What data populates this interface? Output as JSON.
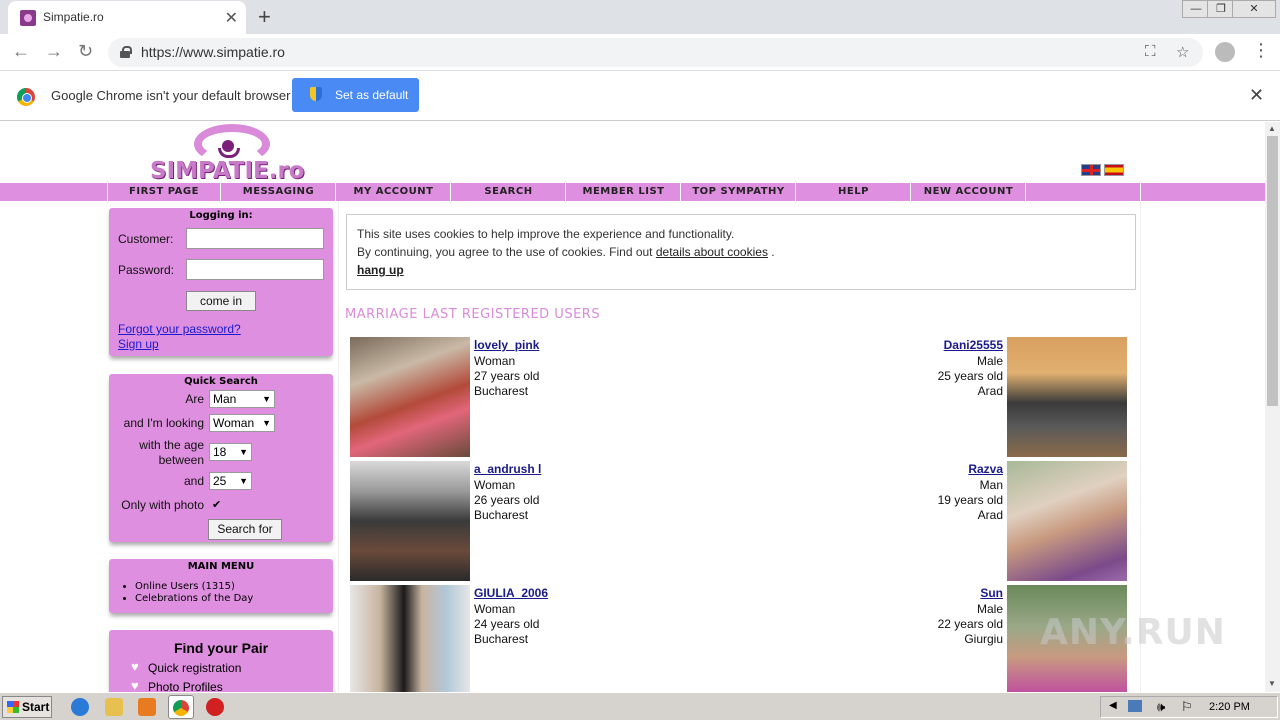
{
  "browser": {
    "tab_title": "Simpatie.ro",
    "url": "https://www.simpatie.ro",
    "infobar_text": "Google Chrome isn't your default browser",
    "infobar_button": "Set as default"
  },
  "site": {
    "logo_text": "SIMPATIE.ro",
    "nav": [
      "FIRST PAGE",
      "MESSAGING",
      "MY ACCOUNT",
      "SEARCH",
      "MEMBER LIST",
      "TOP SYMPATHY",
      "HELP",
      "NEW ACCOUNT"
    ]
  },
  "login": {
    "title": "Logging in:",
    "customer_label": "Customer:",
    "password_label": "Password:",
    "button": "come in",
    "forgot": "Forgot your password?",
    "signup": "Sign up"
  },
  "quick_search": {
    "title": "Quick Search",
    "are_label": "Are",
    "are_value": "Man",
    "looking_label": "and I'm looking",
    "looking_value": "Woman",
    "age_label_1": "with the age",
    "age_label_2": "between",
    "age_from": "18",
    "and_label": "and",
    "age_to": "25",
    "photo_label": "Only with photo",
    "photo_checked": true,
    "button": "Search for"
  },
  "main_menu": {
    "title": "MAIN MENU",
    "items": [
      "Online Users (1315)",
      "Celebrations of the Day"
    ]
  },
  "find_pair": {
    "title": "Find your Pair",
    "items": [
      "Quick registration",
      "Photo Profiles"
    ]
  },
  "cookie": {
    "line1": "This site uses cookies to help improve the experience and functionality.",
    "line2_pre": "By continuing, you agree to the use of cookies. Find out",
    "line2_link": "details about cookies",
    "line2_post": ".",
    "dismiss": "hang up"
  },
  "section_title": "MARRIAGE LAST REGISTERED USERS",
  "users_left": [
    {
      "name": "lovely_pink",
      "gender": "Woman",
      "age": "27 years old",
      "city": "Bucharest"
    },
    {
      "name": "a_andrush l",
      "gender": "Woman",
      "age": "26 years old",
      "city": "Bucharest"
    },
    {
      "name": "GIULIA_2006",
      "gender": "Woman",
      "age": "24 years old",
      "city": "Bucharest"
    }
  ],
  "users_right": [
    {
      "name": "Dani25555",
      "gender": "Male",
      "age": "25 years old",
      "city": "Arad"
    },
    {
      "name": "Razva",
      "gender": "Man",
      "age": "19 years old",
      "city": "Arad"
    },
    {
      "name": "Sun",
      "gender": "Male",
      "age": "22 years old",
      "city": "Giurgiu"
    }
  ],
  "watermark": "ANY.RUN",
  "taskbar": {
    "start": "Start",
    "clock": "2:20 PM"
  }
}
